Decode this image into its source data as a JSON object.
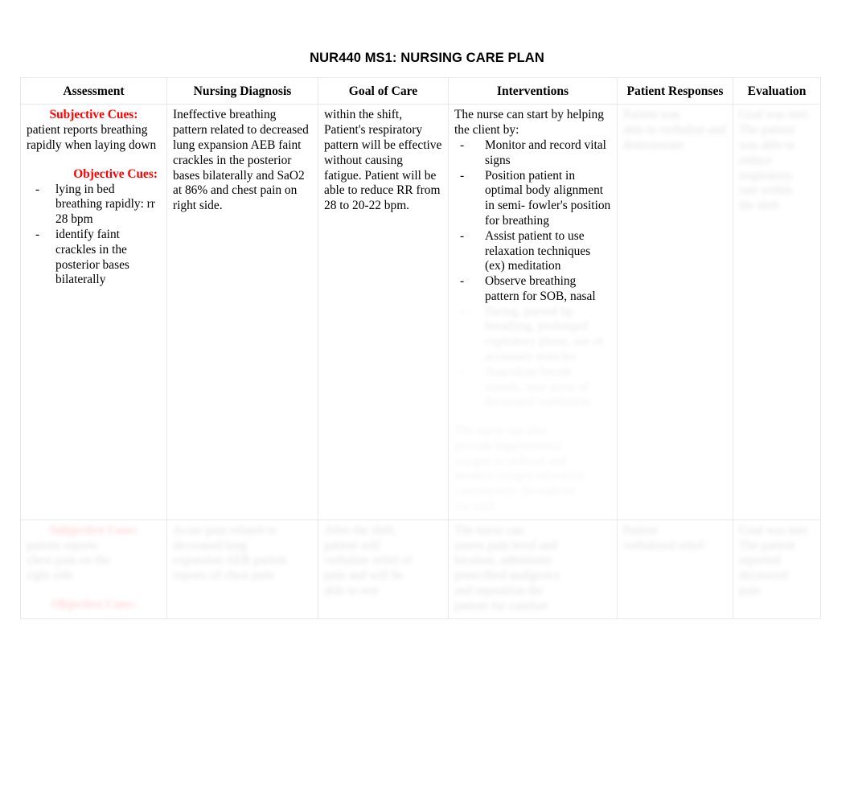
{
  "document": {
    "title": "NUR440 MS1: NURSING CARE PLAN"
  },
  "table": {
    "headers": [
      "Assessment",
      "Nursing Diagnosis",
      "Goal of Care",
      "Interventions",
      "Patient Responses",
      "Evaluation"
    ],
    "rows": [
      {
        "assessment": {
          "subjective_label": "Subjective Cues:",
          "subjective_text": "patient reports breathing rapidly when laying down",
          "objective_label": "Objective Cues:",
          "objective_items": [
            "lying in bed breathing rapidly: rr 28 bpm",
            "identify faint crackles in the posterior bases bilaterally"
          ]
        },
        "nursing_diagnosis": "Ineffective breathing pattern related to decreased lung expansion AEB faint crackles in the posterior bases bilaterally and SaO2 at 86% and chest pain on right side.",
        "goal_of_care": "within the shift, Patient's respiratory pattern will be effective without causing fatigue. Patient will be able to reduce RR from 28 to 20-22 bpm.",
        "interventions": {
          "intro": "The nurse can start by helping the client by:",
          "items": [
            "Monitor and record vital signs",
            "Position patient in optimal body alignment in semi- fowler's position for breathing",
            "Assist patient to use relaxation techniques (ex) meditation",
            "Observe breathing pattern for SOB, nasal"
          ],
          "faded_items": [
            "flaring, pursed lip breathing, prolonged expiratory phase, use of accessory muscles",
            "Auscultate breath sounds, note areas of decreased ventilation"
          ],
          "faded_trailing": "The nurse can also",
          "faded_trailing_lines": [
            "provide supplemental",
            "oxygen as ordered and",
            "monitor oxygen saturation",
            "continuously throughout",
            "the shift"
          ]
        },
        "patient_responses_faded": [
          "Patient was",
          "able to verbalize and",
          "demonstrate"
        ],
        "evaluation_faded": [
          "Goal was met.",
          "The patient",
          "was able to",
          "reduce",
          "respiratory",
          "rate within",
          "the shift"
        ]
      },
      {
        "assessment": {
          "subjective_label": "Subjective Cues:",
          "subjective_faded": [
            "patient reports",
            "chest pain on the",
            "right side"
          ],
          "objective_label": "Objective Cues:"
        },
        "nursing_diagnosis_faded": [
          "Acute pain related to",
          "decreased lung",
          "expansion AEB patient",
          "reports of chest pain"
        ],
        "goal_of_care_faded": [
          "After the shift,",
          "patient will",
          "verbalize relief of",
          "pain and will be",
          "able to rest"
        ],
        "interventions_faded": [
          "The nurse can",
          "assess pain level and",
          "location, administer",
          "prescribed analgesics",
          "and reposition the",
          "patient for comfort"
        ],
        "patient_responses_faded": [
          "Patient",
          "verbalized relief"
        ],
        "evaluation_faded": [
          "Goal was met.",
          "The patient",
          "reported",
          "decreased",
          "pain"
        ]
      }
    ]
  }
}
